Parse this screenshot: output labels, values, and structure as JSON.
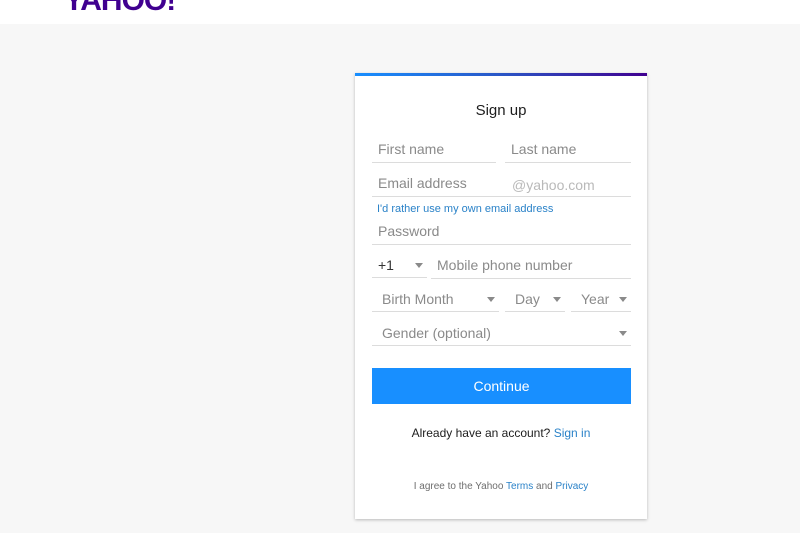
{
  "header": {
    "logo_text": "YAHOO!"
  },
  "colors": {
    "brand": "#400090",
    "accent": "#188fff",
    "link": "#2a82c8"
  },
  "form": {
    "title": "Sign up",
    "first_name": {
      "placeholder": "First name",
      "value": ""
    },
    "last_name": {
      "placeholder": "Last name",
      "value": ""
    },
    "email": {
      "placeholder": "Email address",
      "value": "",
      "suffix": "@yahoo.com"
    },
    "own_email_link": "I'd rather use my own email address",
    "password": {
      "placeholder": "Password",
      "value": ""
    },
    "country_code": {
      "selected": "+1"
    },
    "phone": {
      "placeholder": "Mobile phone number",
      "value": ""
    },
    "birth_month": {
      "selected": "Birth Month"
    },
    "birth_day": {
      "selected": "Day"
    },
    "birth_year": {
      "selected": "Year"
    },
    "gender": {
      "selected": "Gender (optional)"
    },
    "continue_label": "Continue"
  },
  "footer": {
    "already_text": "Already have an account?",
    "sign_in_label": "Sign in",
    "terms_prefix": "I agree to the Yahoo",
    "terms_label": "Terms",
    "and_text": "and",
    "privacy_label": "Privacy"
  }
}
